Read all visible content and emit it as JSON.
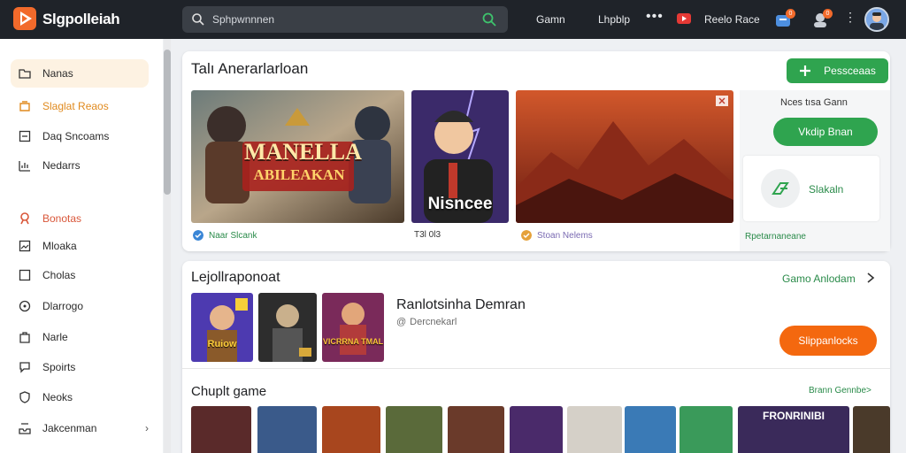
{
  "topbar": {
    "brand": "Slgpolleiah",
    "search_placeholder": "Sphpwnnnen",
    "nav": [
      "Gamn",
      "Lhpblp"
    ],
    "more": "•••",
    "promo": "Reelo Race",
    "badges": [
      "0",
      "0"
    ]
  },
  "sidebar": {
    "items": [
      {
        "label": "Nanas",
        "icon": "folder-icon"
      },
      {
        "label": "Slaglat Reaos",
        "icon": "bookmark-icon"
      },
      {
        "label": "Daq Sncoams",
        "icon": "square-icon"
      },
      {
        "label": "Nedarrs",
        "icon": "chart-icon"
      },
      {
        "label": "Bonotas",
        "icon": "person-icon"
      },
      {
        "label": "Mloaka",
        "icon": "image-icon"
      },
      {
        "label": "Cholas",
        "icon": "square-icon"
      },
      {
        "label": "Dlarrogo",
        "icon": "target-icon"
      },
      {
        "label": "Narle",
        "icon": "bag-icon"
      },
      {
        "label": "Spoirts",
        "icon": "chat-icon"
      },
      {
        "label": "Neoks",
        "icon": "shield-icon"
      },
      {
        "label": "Jakcenman",
        "icon": "inbox-icon",
        "chevron": "›"
      }
    ]
  },
  "featured": {
    "title": "Talı Anerarlarloan",
    "button": "Pessceaas",
    "tiles": [
      {
        "art_line1": "MANELLA",
        "art_line2": "ABILEAKAN",
        "caption": "Naar Slcank"
      },
      {
        "art_text": "Nisncee",
        "caption": "T3l 0l3"
      },
      {
        "caption": "Stoan Nelems"
      }
    ],
    "side": {
      "top_text": "Nces tısa Gann",
      "green_button": "Vkdip Bnan",
      "card_label": "Slakaln",
      "footer": "Rpetarnaneane"
    }
  },
  "recommended": {
    "title": "Lejollraponoat",
    "link": "Gamo Anlodam",
    "item_title": "Ranlotsinha Demran",
    "item_meta": "Dercnekarl",
    "button": "Slippanlocks",
    "tiles": [
      "Ruiow",
      "",
      "VICRRNA TMAL"
    ]
  },
  "popular": {
    "title": "Chuplt game",
    "link": "Brann Gennbe>",
    "tiles": [
      "",
      "",
      "",
      "",
      "",
      "",
      "",
      "",
      "",
      "FRONRINIBI",
      ""
    ]
  },
  "colors": {
    "topbar": "#1f2329",
    "accent_green": "#2fa44f",
    "accent_orange": "#f4680f"
  }
}
